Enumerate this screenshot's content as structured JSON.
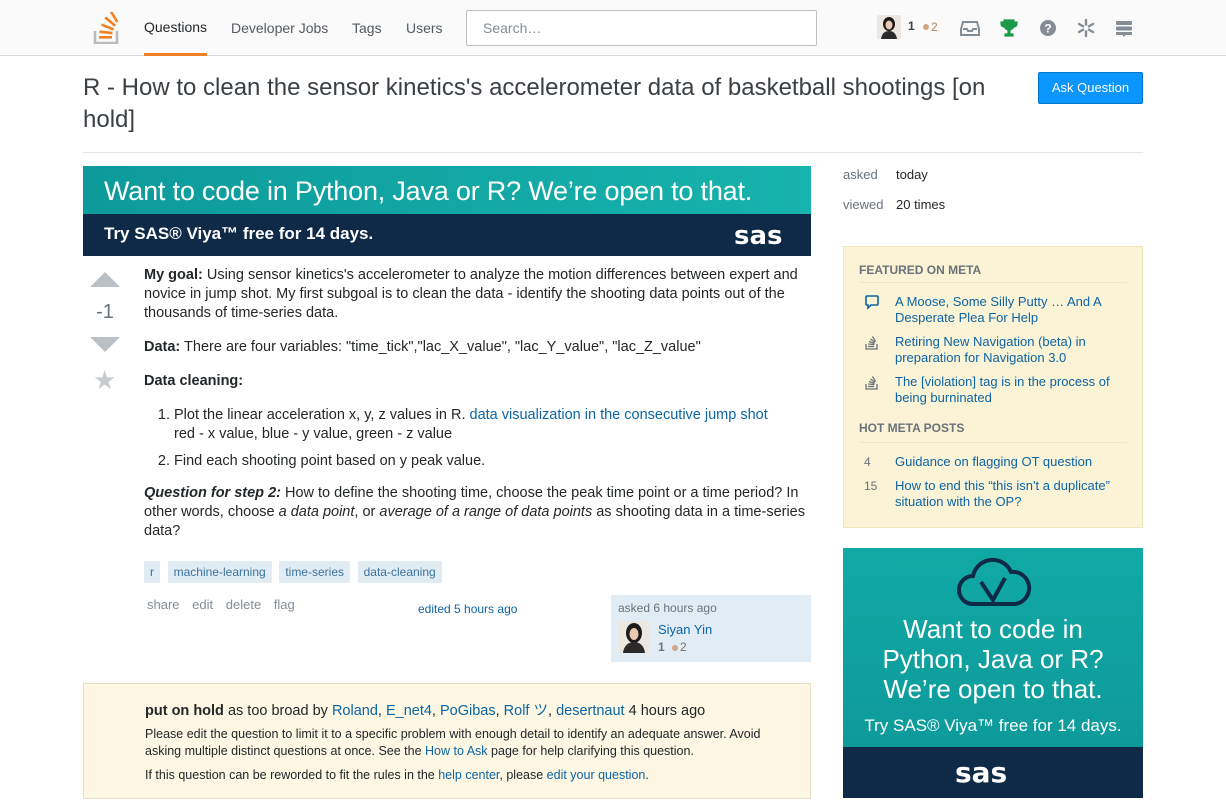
{
  "topbar": {
    "nav": [
      "Questions",
      "Developer Jobs",
      "Tags",
      "Users"
    ],
    "search_placeholder": "Search…",
    "reputation": "1",
    "bronze": "2"
  },
  "question": {
    "title": "R - How to clean the sensor kinetics's accelerometer data of basketball shootings [on hold]",
    "ask_button": "Ask Question",
    "votes": "-1",
    "goal_label": "My goal:",
    "goal_text": " Using sensor kinetics's accelerometer to analyze the motion differences between expert and novice in jump shot. My first subgoal is to clean the data - identify the shooting data points out of the thousands of time-series data.",
    "data_label": "Data:",
    "data_text": " There are four variables: \"time_tick\",\"lac_X_value\", \"lac_Y_value\", \"lac_Z_value\"",
    "cleaning_label": "Data cleaning:",
    "step1_text": "Plot the linear acceleration x, y, z values in R. ",
    "step1_link": "data visualization in the consecutive jump shot",
    "step1_text2": "red - x value, blue - y value, green - z value",
    "step2_text": "Find each shooting point based on y peak value.",
    "q2_label": "Question for step 2:",
    "q2_text1": " How to define the shooting time, choose the peak time point or a time period? In other words, choose ",
    "q2_em1": "a data point",
    "q2_text2": ", or ",
    "q2_em2": "average of a range of data points",
    "q2_text3": " as shooting data in a time-series data?",
    "tags": [
      "r",
      "machine-learning",
      "time-series",
      "data-cleaning"
    ],
    "menu": [
      "share",
      "edit",
      "delete",
      "flag"
    ],
    "edited": "edited 5 hours ago",
    "asked_ago": "asked 6 hours ago",
    "owner_name": "Siyan Yin",
    "owner_rep": "1",
    "owner_bronze": "2"
  },
  "ads": {
    "wide_headline": "Want to code in Python, Java or R? We’re open to that.",
    "wide_sub": "Try SAS® Viya™ free for 14 days.",
    "tall_headline_1": "Want to code in",
    "tall_headline_2": "Python, Java or R?",
    "tall_headline_3": "We’re open to that.",
    "tall_sub": "Try SAS® Viya™ free for 14 days.",
    "brand": "sas"
  },
  "hold": {
    "label": "put on hold",
    "reason": " as too broad by ",
    "voters": [
      "Roland",
      "E_net4",
      "PoGibas",
      "Rolf ツ",
      "desertnaut"
    ],
    "time": " 4 hours ago",
    "body_1": "Please edit the question to limit it to a specific problem with enough detail to identify an adequate answer. Avoid asking multiple distinct questions at once. See the ",
    "body_link": "How to Ask",
    "body_2": " page for help clarifying this question.",
    "reword_1": "If this question can be reworded to fit the rules in the ",
    "reword_link1": "help center",
    "reword_2": ", please ",
    "reword_link2": "edit your question",
    "reword_3": "."
  },
  "sidebar": {
    "asked_label": "asked",
    "asked_value": "today",
    "viewed_label": "viewed",
    "viewed_value": "20 times",
    "featured_heading": "FEATURED ON META",
    "featured": [
      "A Moose, Some Silly Putty … And A Desperate Plea For Help",
      "Retiring New Navigation (beta) in preparation for Navigation 3.0",
      "The [violation] tag is in the process of being burninated"
    ],
    "hot_heading": "HOT META POSTS",
    "hot": [
      {
        "count": "4",
        "title": "Guidance on flagging OT question"
      },
      {
        "count": "15",
        "title": "How to end this “this isn't a duplicate” situation with the OP?"
      }
    ]
  },
  "colors": {
    "accent": "#f48024",
    "link": "#0c65a5",
    "button": "#0a95ff",
    "meta_bg": "#fbf3d5",
    "hold_bg": "#fdf7e3"
  }
}
